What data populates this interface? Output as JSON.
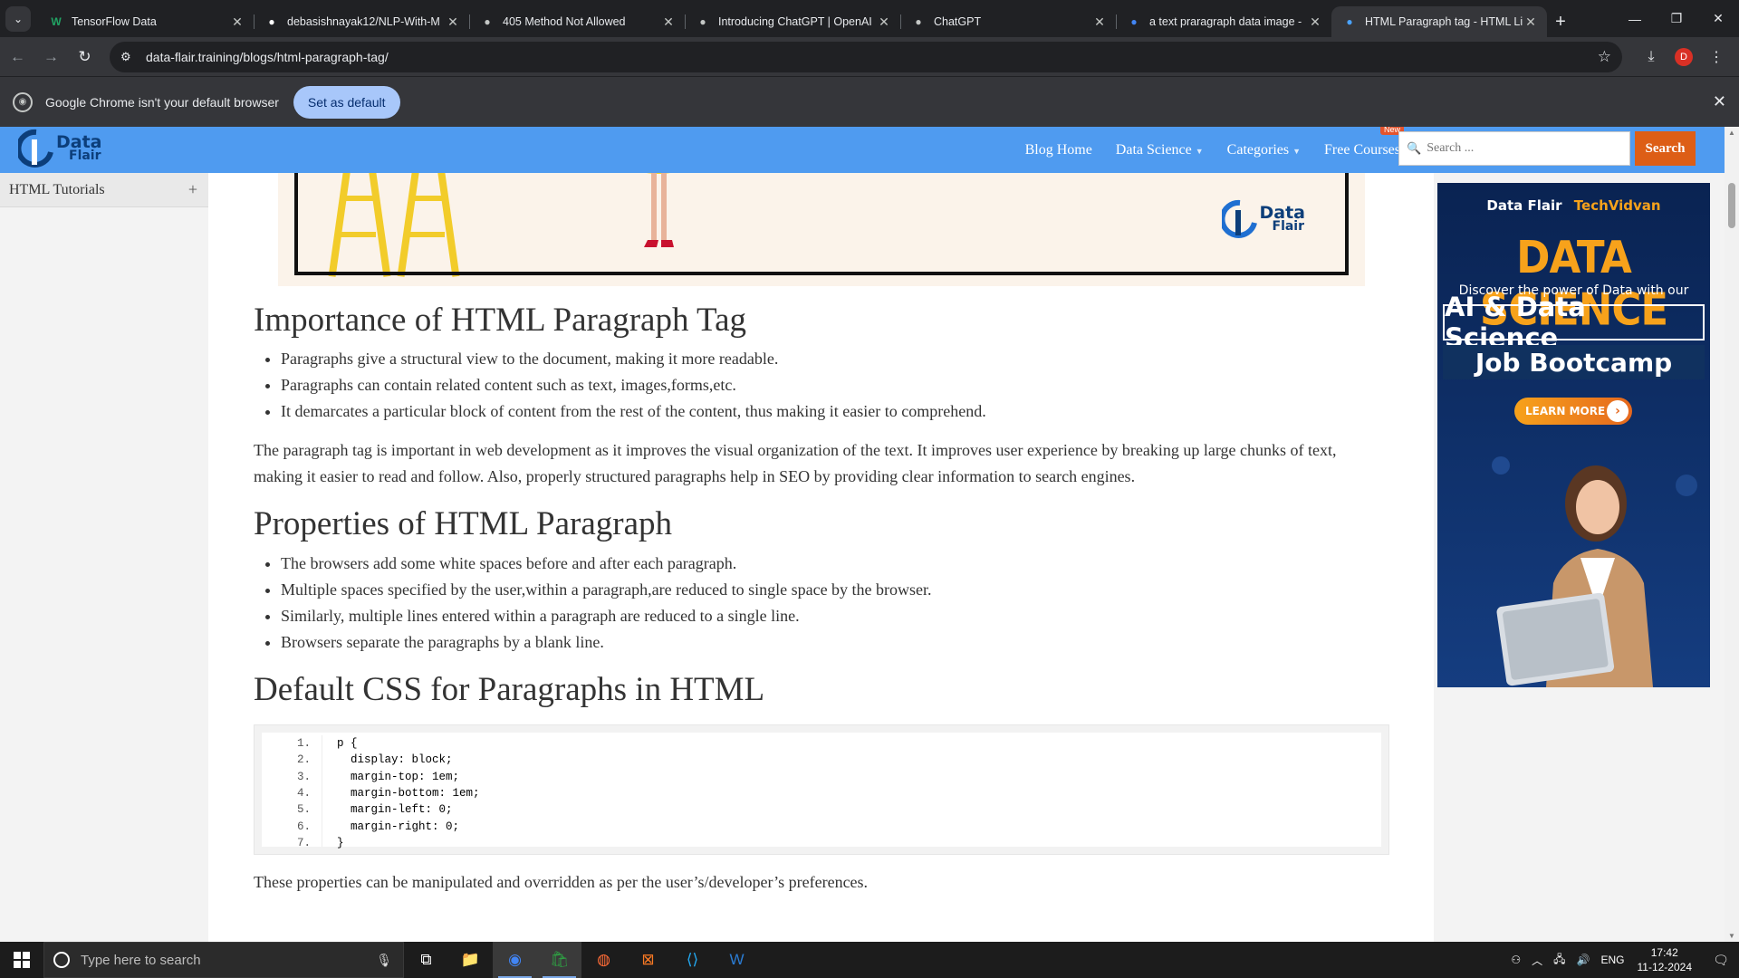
{
  "browser": {
    "tabs": [
      {
        "title": "TensorFlow Data",
        "favicon": "W",
        "favicon_color": "#21a464",
        "active": false
      },
      {
        "title": "debasishnayak12/NLP-With-M",
        "favicon": "github-icon",
        "favicon_color": "#ffffff",
        "active": false
      },
      {
        "title": "405 Method Not Allowed",
        "favicon": "globe-icon",
        "favicon_color": "#c4c7c5",
        "active": false
      },
      {
        "title": "Introducing ChatGPT | OpenAI",
        "favicon": "openai-icon",
        "favicon_color": "#c4c7c5",
        "active": false
      },
      {
        "title": "ChatGPT",
        "favicon": "openai-icon",
        "favicon_color": "#c4c7c5",
        "active": false
      },
      {
        "title": "a text praragraph data image -",
        "favicon": "google-icon",
        "favicon_color": "#4285f4",
        "active": false
      },
      {
        "title": "HTML Paragraph tag - HTML Li",
        "favicon": "dataflair-icon",
        "favicon_color": "#4aa3ff",
        "active": true
      }
    ],
    "url": "data-flair.training/blogs/html-paragraph-tag/",
    "profile_initial": "D",
    "infobar": {
      "message": "Google Chrome isn't your default browser",
      "button": "Set as default"
    }
  },
  "site": {
    "logo_line1": "Data",
    "logo_line2": "Flair",
    "nav": {
      "blog_home": "Blog Home",
      "data_science": "Data Science",
      "categories": "Categories",
      "free_courses": "Free Courses",
      "new_badge": "New"
    },
    "search_placeholder": "Search ...",
    "search_button": "Search",
    "colors": {
      "header": "#4f9bf0",
      "search_button": "#dd5e16"
    }
  },
  "sidebar": {
    "items": [
      {
        "label": "HTML Tutorials",
        "icon": "plus-icon"
      }
    ]
  },
  "article": {
    "section1": {
      "heading": "Importance of HTML Paragraph Tag",
      "bullets": [
        "Paragraphs give a structural view to the document, making it more readable.",
        "Paragraphs can contain related content such as text, images,forms,etc.",
        "It demarcates a particular block of content from the rest of the content, thus making it easier to comprehend."
      ],
      "paragraph": "The paragraph tag is important in web development as it improves the visual organization of the text. It improves user experience by breaking up large chunks of text, making it easier to read and follow. Also, properly structured paragraphs help in SEO by providing clear information to search engines."
    },
    "section2": {
      "heading": "Properties of HTML Paragraph",
      "bullets": [
        "The browsers add some white spaces before and after each paragraph.",
        "Multiple spaces specified by the user,within a paragraph,are reduced to single space by the browser.",
        "Similarly, multiple lines entered within a paragraph are reduced to a single line.",
        "Browsers separate the paragraphs by a blank line."
      ]
    },
    "section3": {
      "heading": "Default CSS for Paragraphs in HTML",
      "code_line_numbers": [
        "1.",
        "2.",
        "3.",
        "4.",
        "5.",
        "6.",
        "7."
      ],
      "code_lines": [
        "p {",
        "  display: block;",
        "  margin-top: 1em;",
        "  margin-bottom: 1em;",
        "  margin-left: 0;",
        "  margin-right: 0;",
        "}"
      ],
      "after": "These properties can be manipulated and overridden as per the user’s/developer’s preferences."
    },
    "hero_logo_line1": "Data",
    "hero_logo_line2": "Flair"
  },
  "ad": {
    "brand1": "Data Flair",
    "brand2": "TechVidvan",
    "headline": "DATA SCIENCE",
    "subline": "Discover the power of Data with our",
    "box1": "AI & Data Science",
    "box2": "Job Bootcamp",
    "cta": "LEARN MORE"
  },
  "taskbar": {
    "search_placeholder": "Type here to search",
    "apps": [
      {
        "name": "task-view-icon",
        "glyph": "⧉"
      },
      {
        "name": "file-explorer-icon",
        "glyph": "📁"
      },
      {
        "name": "chrome-icon",
        "glyph": "◉"
      },
      {
        "name": "store-icon",
        "glyph": "🛍"
      },
      {
        "name": "postman-icon",
        "glyph": "◍"
      },
      {
        "name": "xampp-icon",
        "glyph": "⊠"
      },
      {
        "name": "vscode-icon",
        "glyph": "⟨⟩"
      },
      {
        "name": "word-icon",
        "glyph": "W"
      }
    ],
    "language": "ENG",
    "time": "17:42",
    "date": "11-12-2024"
  }
}
